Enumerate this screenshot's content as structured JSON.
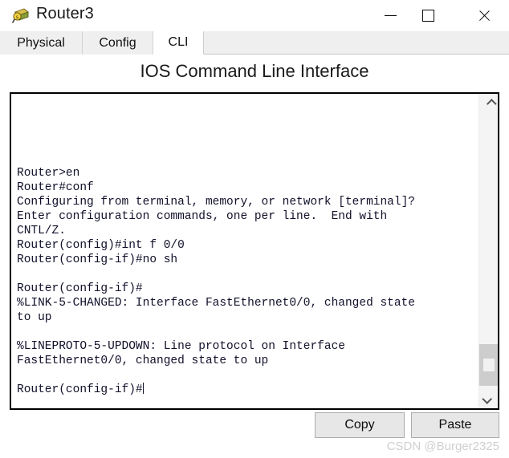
{
  "window": {
    "title": "Router3",
    "icon": "packet-tracer-router-icon",
    "controls": {
      "minimize": "minimize-icon",
      "maximize": "maximize-icon",
      "close": "close-icon"
    }
  },
  "tabs": [
    {
      "label": "Physical",
      "active": false
    },
    {
      "label": "Config",
      "active": false
    },
    {
      "label": "CLI",
      "active": true
    }
  ],
  "heading": "IOS Command Line Interface",
  "terminal": {
    "lines": [
      "",
      "",
      "",
      "",
      "",
      "Router>en",
      "Router#conf",
      "Configuring from terminal, memory, or network [terminal]?",
      "Enter configuration commands, one per line.  End with",
      "CNTL/Z.",
      "Router(config)#int f 0/0",
      "Router(config-if)#no sh",
      "",
      "Router(config-if)#",
      "%LINK-5-CHANGED: Interface FastEthernet0/0, changed state",
      "to up",
      "",
      "%LINEPROTO-5-UPDOWN: Line protocol on Interface",
      "FastEthernet0/0, changed state to up",
      ""
    ],
    "prompt_line": "Router(config-if)#",
    "cursor_visible": true,
    "scrollbar": {
      "up_arrow": "chevron-up-icon",
      "down_arrow": "chevron-down-icon",
      "thumb_position_pct": 80
    }
  },
  "buttons": {
    "copy": "Copy",
    "paste": "Paste"
  },
  "watermark": "CSDN @Burger2325",
  "colors": {
    "tab_strip_bg": "#efefef",
    "active_tab_bg": "#ffffff",
    "terminal_bg": "#ffffff",
    "terminal_text": "#10102a",
    "button_bg": "#e7e7e7",
    "watermark": "#cfcfcf"
  }
}
